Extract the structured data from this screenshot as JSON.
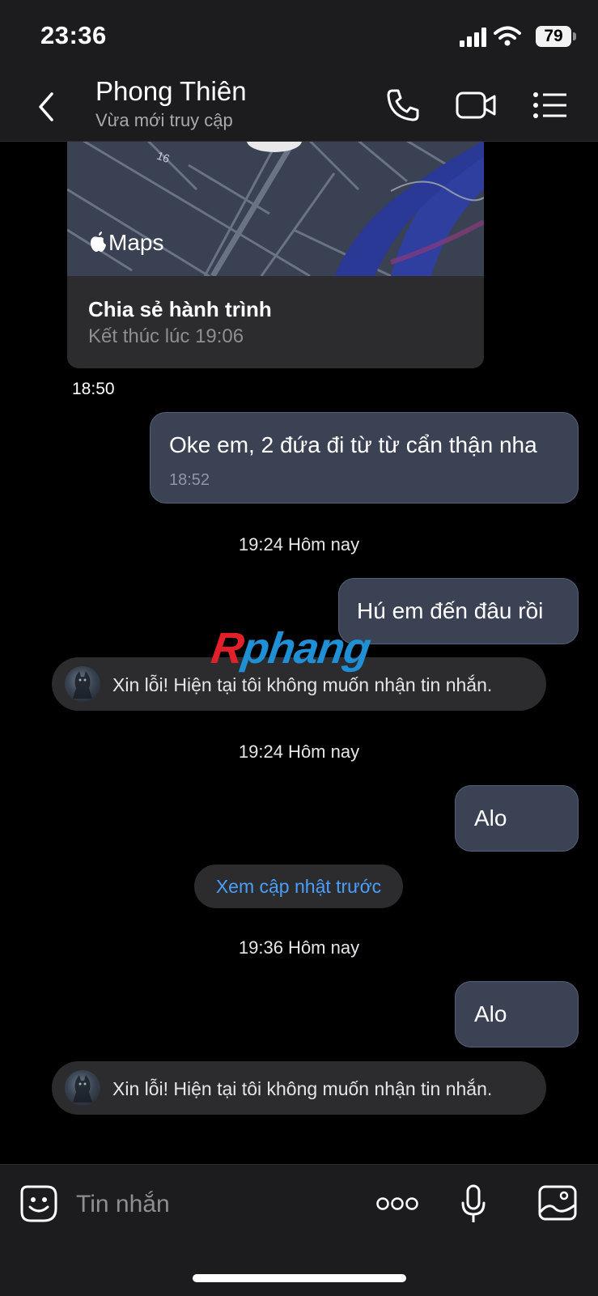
{
  "status_bar": {
    "time": "23:36",
    "battery": "79"
  },
  "header": {
    "contact_name": "Phong Thiên",
    "contact_status": "Vừa mới truy cập",
    "icons": [
      "back-icon",
      "phone-icon",
      "video-call-icon",
      "menu-list-icon"
    ]
  },
  "map_card": {
    "maps_label": "Maps",
    "road_label": "16",
    "title": "Chia sẻ hành trình",
    "subtitle": "Kết thúc lúc 19:06",
    "time": "18:50"
  },
  "messages": {
    "m1": {
      "text": "Oke em, 2 đứa đi từ từ cẩn thận nha",
      "time": "18:52"
    },
    "sep1": "19:24 Hôm nay",
    "m2": {
      "text": "Hú em đến đâu rồi"
    },
    "auto1": "Xin lỗi! Hiện tại tôi không muốn nhận tin nhắn.",
    "sep2": "19:24 Hôm nay",
    "m3": {
      "text": "Alo"
    },
    "see_updates": "Xem cập nhật trước",
    "sep3": "19:36 Hôm nay",
    "m4": {
      "text": "Alo"
    },
    "auto2": "Xin lỗi! Hiện tại tôi không muốn nhận tin nhắn."
  },
  "watermark": {
    "first": "R",
    "rest": "phang"
  },
  "input_bar": {
    "placeholder": "Tin nhắn",
    "icons": [
      "emoji-sticker-icon",
      "more-icon",
      "microphone-icon",
      "image-icon"
    ]
  },
  "colors": {
    "bubble": "#3a4254",
    "bubble_border": "#55607a",
    "link": "#4a9eff",
    "map_road": "#6a7285",
    "map_water": "#2f3fa0"
  }
}
